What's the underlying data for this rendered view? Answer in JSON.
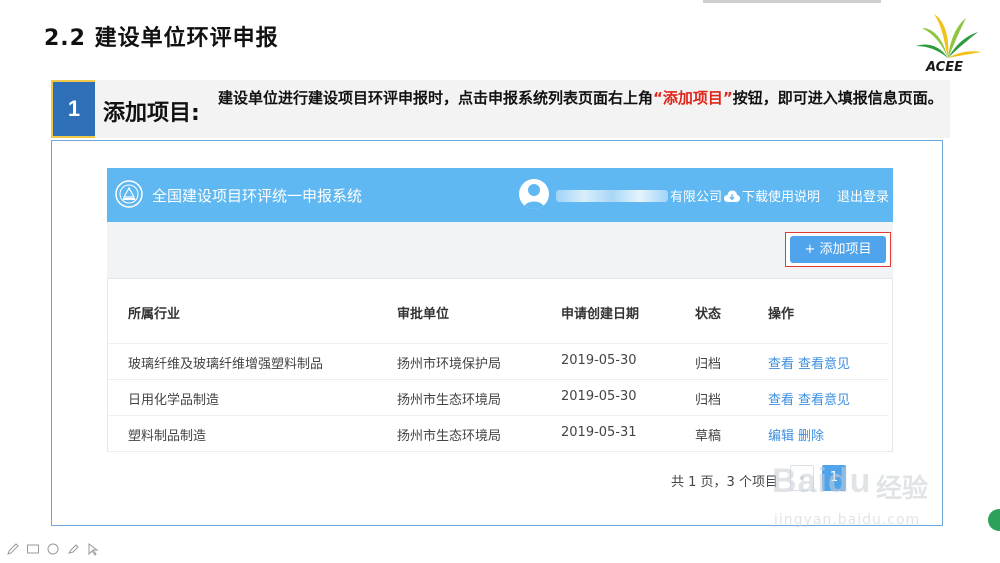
{
  "slide": {
    "title": "2.2  建设单位环评申报",
    "logo_text": "ACEE"
  },
  "step": {
    "number": "1",
    "label": "添加项目:",
    "desc_before": "建设单位进行建设项目环评申报时，点击申报系统列表页面右上角",
    "desc_highlight": "“添加项目”",
    "desc_after": "按钮，即可进入填报信息页面。"
  },
  "app": {
    "title": "全国建设项目环评统一申报系统",
    "company_suffix": "有限公司",
    "download_label": "下载使用说明",
    "logout_label": "退出登录",
    "add_button_label": "+ 添加项目"
  },
  "table": {
    "headers": [
      "所属行业",
      "审批单位",
      "申请创建日期",
      "状态",
      "操作"
    ],
    "rows": [
      {
        "industry": "玻璃纤维及玻璃纤维增强塑料制品",
        "agency": "扬州市环境保护局",
        "date": "2019-05-30",
        "status": "归档",
        "action1": "查看",
        "action2": "查看意见"
      },
      {
        "industry": "日用化学品制造",
        "agency": "扬州市生态环境局",
        "date": "2019-05-30",
        "status": "归档",
        "action1": "查看",
        "action2": "查看意见"
      },
      {
        "industry": "塑料制品制造",
        "agency": "扬州市生态环境局",
        "date": "2019-05-31",
        "status": "草稿",
        "action1": "编辑",
        "action2": "删除"
      }
    ]
  },
  "pager": {
    "summary": "共 1 页，3 个项目",
    "prev": "‹",
    "current": "1"
  },
  "watermark": {
    "brand": "Baidu",
    "cn": "经验",
    "url": "jingyan.baidu.com"
  },
  "colors": {
    "header_blue": "#5fb8f1",
    "button_blue": "#4fa4ec",
    "highlight_red": "#e0251b",
    "link_blue": "#3d8fe0"
  }
}
